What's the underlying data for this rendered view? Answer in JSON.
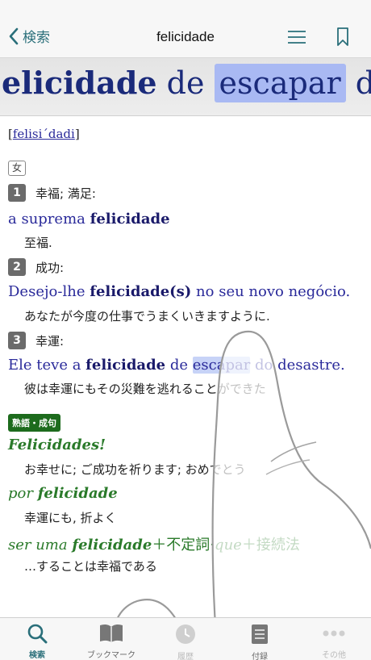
{
  "nav": {
    "back_label": "検索",
    "title": "felicidade"
  },
  "magnifier": {
    "word_bold": "elicidade",
    "word_ghost": "felicidade",
    "rest1": " de ",
    "highlight": "escapar",
    "rest2": " do d"
  },
  "entry": {
    "pron_open": "[",
    "pron": "felisi´dadi",
    "pron_close": "]",
    "gender": "女",
    "senses": [
      {
        "num": "1",
        "gloss": "幸福; 満足:"
      },
      {
        "num": "2",
        "gloss": "成功:"
      },
      {
        "num": "3",
        "gloss": "幸運:"
      }
    ],
    "examples": [
      {
        "pre": "a suprema ",
        "bold": "felicidade",
        "post": "",
        "translation": "至福."
      },
      {
        "pre": "Desejo-lhe ",
        "bold": "felicidade(s)",
        "post": " no seu novo negócio.",
        "translation": "あなたが今度の仕事でうまくいきますように."
      },
      {
        "pre": "Ele teve a ",
        "bold": "felicidade",
        "mid": " de ",
        "hl": "escapar",
        "post": " do desastre.",
        "translation": "彼は幸運にもその災難を逃れることができた"
      }
    ],
    "idiom_tag": "熟語・成句",
    "idioms": [
      {
        "text_italic": "Felicidades!",
        "translation": "お幸せに; ご成功を祈ります; おめでとう"
      },
      {
        "pre": "por ",
        "bold": "felicidade",
        "translation": "幸運にも, 折よく"
      },
      {
        "pre": "ser uma ",
        "bold": "felicidade",
        "plain1": "＋不定詞·",
        "italic2": "que",
        "plain2": "＋接続法",
        "translation": "…することは幸福である"
      }
    ]
  },
  "tabs": [
    {
      "label": "検索",
      "icon": "search-icon"
    },
    {
      "label": "ブックマーク",
      "icon": "book-icon"
    },
    {
      "label": "履歴",
      "icon": "clock-icon"
    },
    {
      "label": "付録",
      "icon": "document-icon"
    },
    {
      "label": "その他",
      "icon": "more-icon"
    }
  ],
  "colors": {
    "accent": "#2a6f7a",
    "entry_blue": "#2a2a9a",
    "idiom_green": "#2a7a2a",
    "highlight": "#a9b9f3"
  }
}
